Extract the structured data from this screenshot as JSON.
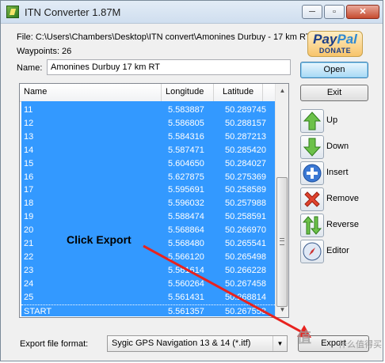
{
  "window": {
    "title": "ITN Converter 1.87M",
    "min": "─",
    "max": "▫",
    "close": "✕"
  },
  "file_label": "File: C:\\Users\\Chambers\\Desktop\\ITN convert\\Amonines Durbuy - 17 km RT",
  "waypoints_label": "Waypoints: 26",
  "name_label": "Name:",
  "name_value": "Amonines Durbuy   17 km RT",
  "paypal": {
    "line1a": "Pay",
    "line1b": "Pal",
    "line2": "DONATE"
  },
  "buttons": {
    "open": "Open",
    "exit": "Exit"
  },
  "actions": [
    {
      "label": "Up",
      "icon": "up-arrow-icon"
    },
    {
      "label": "Down",
      "icon": "down-arrow-icon"
    },
    {
      "label": "Insert",
      "icon": "plus-icon"
    },
    {
      "label": "Remove",
      "icon": "x-icon"
    },
    {
      "label": "Reverse",
      "icon": "reverse-arrows-icon"
    },
    {
      "label": "Editor",
      "icon": "compass-icon"
    }
  ],
  "grid": {
    "columns": [
      "Name",
      "Longitude",
      "Latitude"
    ],
    "rows": [
      [
        "11",
        "5.583887",
        "50.289745"
      ],
      [
        "12",
        "5.586805",
        "50.288157"
      ],
      [
        "13",
        "5.584316",
        "50.287213"
      ],
      [
        "14",
        "5.587471",
        "50.285420"
      ],
      [
        "15",
        "5.604650",
        "50.284027"
      ],
      [
        "16",
        "5.627875",
        "50.275369"
      ],
      [
        "17",
        "5.595691",
        "50.258589"
      ],
      [
        "18",
        "5.596032",
        "50.257988"
      ],
      [
        "19",
        "5.588474",
        "50.258591"
      ],
      [
        "20",
        "5.568864",
        "50.266970"
      ],
      [
        "21",
        "5.568480",
        "50.265541"
      ],
      [
        "22",
        "5.566120",
        "50.265498"
      ],
      [
        "23",
        "5.561614",
        "50.266228"
      ],
      [
        "24",
        "5.560264",
        "50.267458"
      ],
      [
        "25",
        "5.561431",
        "50.268814"
      ],
      [
        "START",
        "5.561357",
        "50.267558"
      ]
    ]
  },
  "export": {
    "label": "Export file format:",
    "selected": "Sygic GPS Navigation 13 & 14 (*.itf)",
    "button": "Export"
  },
  "annotation": "Click Export",
  "watermark": {
    "main": "值",
    "sub": "什么值得买"
  },
  "colors": {
    "selection": "#3399ff",
    "arrow": "#e8231f"
  }
}
